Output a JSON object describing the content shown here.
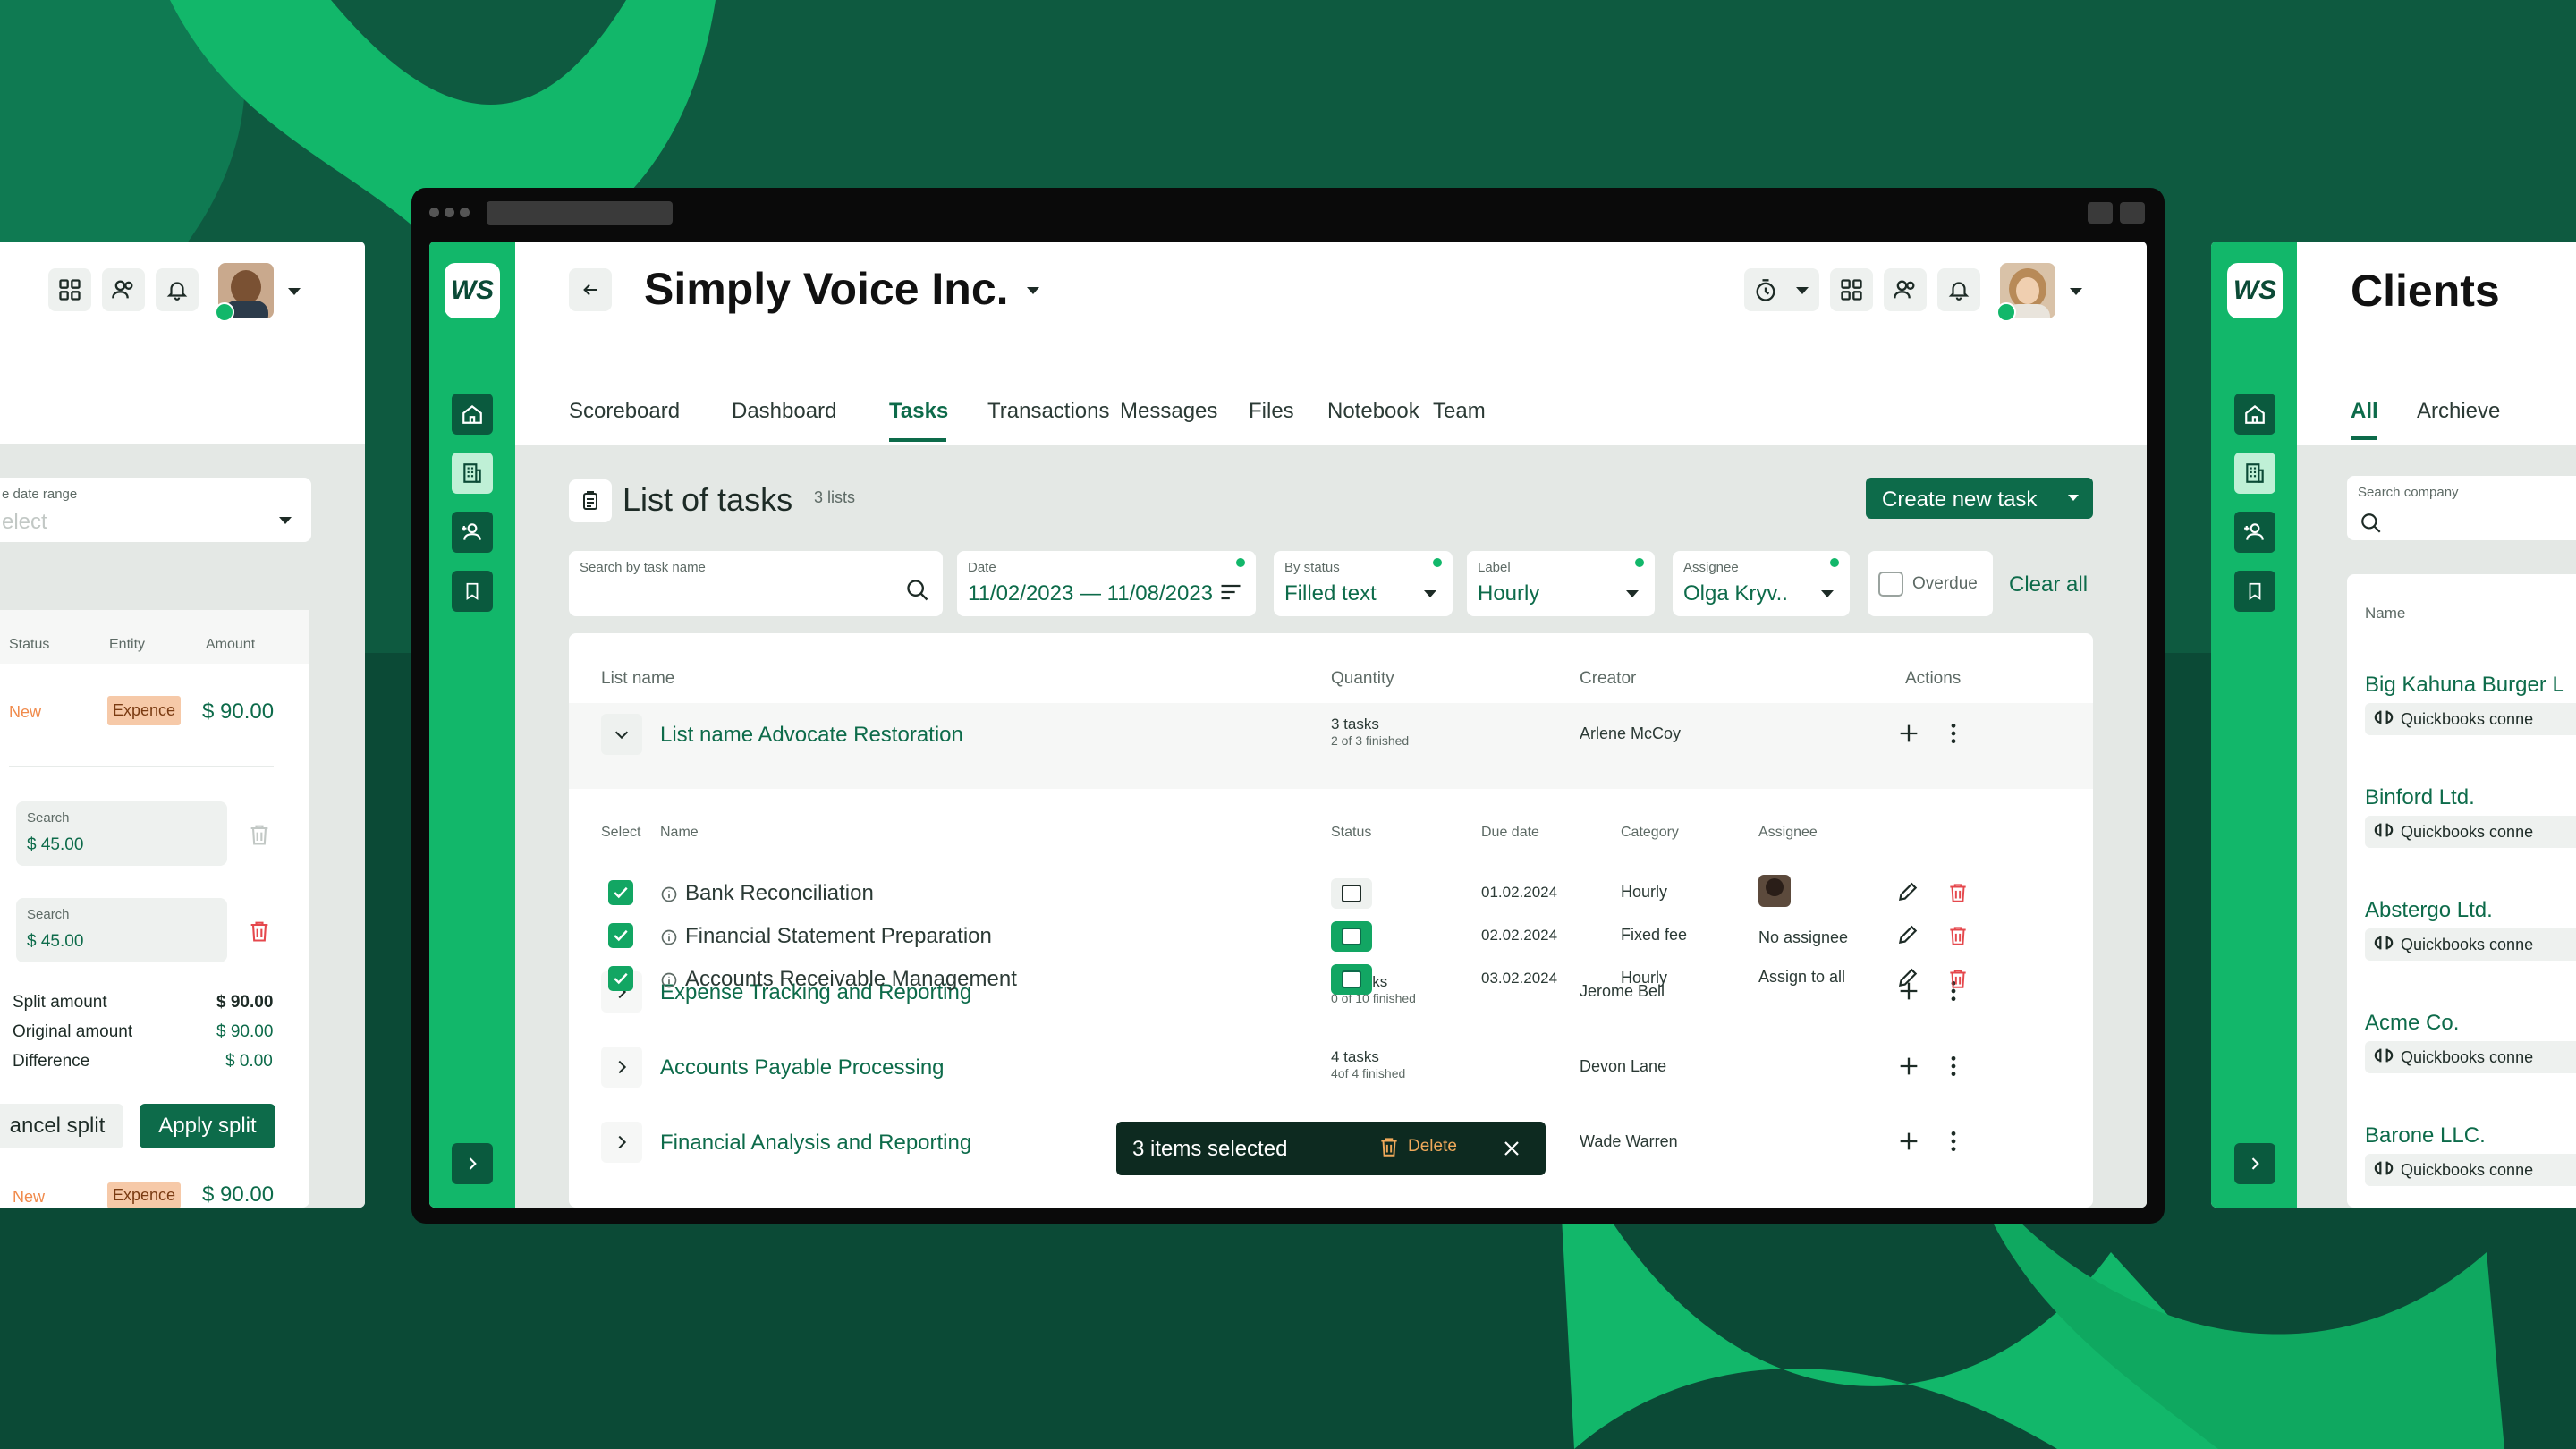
{
  "colors": {
    "brand": "#12b76a",
    "dark": "#0b4a36",
    "accent": "#0d6b4a",
    "danger": "#e5484d",
    "expense_bg": "#f6c9a8"
  },
  "app": {
    "company": "Simply Voice Inc.",
    "tabs": [
      "Scoreboard",
      "Dashboard",
      "Tasks",
      "Transactions",
      "Messages",
      "Files",
      "Notebook",
      "Team"
    ],
    "active_tab": "Tasks"
  },
  "tasks": {
    "title": "List of tasks",
    "count": "3 lists",
    "create_button": "Create new task",
    "filters": {
      "search": {
        "label": "Search by task name",
        "value": ""
      },
      "date": {
        "label": "Date",
        "value": "11/02/2023 — 11/08/2023"
      },
      "status": {
        "label": "By status",
        "value": "Filled text"
      },
      "label": {
        "label": "Label",
        "value": "Hourly"
      },
      "assignee": {
        "label": "Assignee",
        "value": "Olga Kryv.."
      },
      "overdue": "Overdue",
      "clear": "Clear all"
    },
    "columns": {
      "list_name": "List name",
      "quantity": "Quantity",
      "creator": "Creator",
      "actions": "Actions"
    },
    "sub_columns": {
      "select": "Select",
      "name": "Name",
      "status": "Status",
      "due": "Due date",
      "category": "Category",
      "assignee": "Assignee"
    },
    "lists": [
      {
        "name": "List name Advocate Restoration",
        "qty": "3 tasks",
        "finished": "2 of 3 finished",
        "creator": "Arlene McCoy"
      },
      {
        "name": "Expense Tracking and Reporting",
        "qty": "10 tasks",
        "finished": "0 of 10 finished",
        "creator": "Jerome Bell"
      },
      {
        "name": "Accounts Payable Processing",
        "qty": "4 tasks",
        "finished": "4of 4 finished",
        "creator": "Devon Lane"
      },
      {
        "name": "Financial Analysis and Reporting",
        "qty": "",
        "finished": "",
        "creator": "Wade Warren"
      }
    ],
    "subtasks": [
      {
        "name": "Bank Reconciliation",
        "due": "01.02.2024",
        "category": "Hourly",
        "assignee": ""
      },
      {
        "name": "Financial Statement Preparation",
        "due": "02.02.2024",
        "category": "Fixed fee",
        "assignee": "No assignee"
      },
      {
        "name": "Accounts Receivable Management",
        "due": "03.02.2024",
        "category": "Hourly",
        "assignee": "Assign to all"
      }
    ],
    "selection_bar": {
      "text": "3 items selected",
      "delete": "Delete"
    }
  },
  "left_panel": {
    "date_range_label": "e date range",
    "date_range_value": "elect",
    "columns": [
      "Status",
      "Entity",
      "Amount"
    ],
    "row": {
      "status": "New",
      "entity": "Expence",
      "amount": "$ 90.00"
    },
    "split_rows": [
      {
        "label": "Search",
        "value": "$ 45.00"
      },
      {
        "label": "Search",
        "value": "$ 45.00"
      }
    ],
    "summary": [
      {
        "label": "Split amount",
        "value": "$ 90.00"
      },
      {
        "label": "Original amount",
        "value": "$ 90.00"
      },
      {
        "label": "Difference",
        "value": "$ 0.00"
      }
    ],
    "cancel": "ancel split",
    "apply": "Apply split",
    "bottom_row": {
      "status": "New",
      "entity": "Expence",
      "amount": "$ 90.00"
    }
  },
  "right_panel": {
    "title": "Clients",
    "tabs": [
      "All",
      "Archieve"
    ],
    "search_label": "Search company",
    "column": "Name",
    "badge": "Quickbooks conne",
    "clients": [
      "Big Kahuna Burger L",
      "Binford Ltd.",
      "Abstergo Ltd.",
      "Acme Co.",
      "Barone LLC."
    ]
  }
}
